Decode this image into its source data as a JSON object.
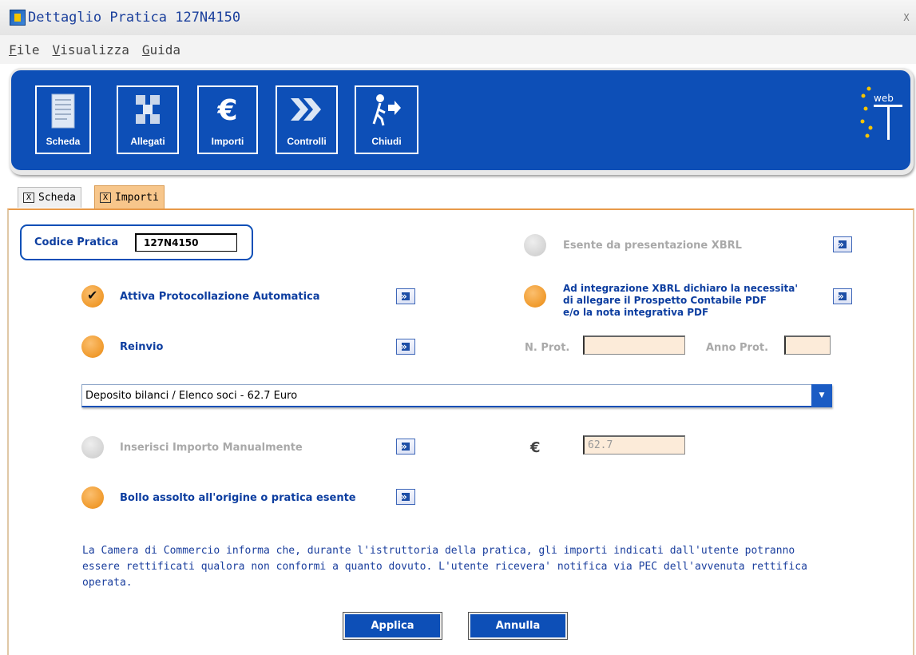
{
  "window": {
    "title": "Dettaglio Pratica 127N4150",
    "close_glyph": "X"
  },
  "menu": [
    {
      "u": "F",
      "rest": "ile"
    },
    {
      "u": "V",
      "rest": "isualizza"
    },
    {
      "u": "G",
      "rest": "uida"
    }
  ],
  "toolbar": {
    "buttons": [
      {
        "label": "Scheda",
        "icon": "document-icon"
      },
      {
        "label": "Allegati",
        "icon": "attachments-icon"
      },
      {
        "label": "Importi",
        "icon": "euro-icon"
      },
      {
        "label": "Controlli",
        "icon": "double-chevron-icon"
      },
      {
        "label": "Chiudi",
        "icon": "exit-walking-icon"
      }
    ],
    "logo_text": "web"
  },
  "tabs": [
    {
      "label": "Scheda",
      "close": "X"
    },
    {
      "label": "Importi",
      "close": "X"
    }
  ],
  "form": {
    "codice_label": "Codice Pratica",
    "codice_value": "127N4150",
    "esente_label": "Esente da presentazione XBRL",
    "attiva_label": "Attiva Protocollazione Automatica",
    "integrazione_lines": [
      "Ad integrazione XBRL dichiaro la necessita'",
      "di allegare il Prospetto Contabile PDF",
      "e/o la nota integrativa PDF"
    ],
    "reinvio_label": "Reinvio",
    "nprot_label": "N. Prot.",
    "nprot_value": "",
    "anno_label": "Anno Prot.",
    "anno_value": "",
    "select_value": "Deposito bilanci / Elenco soci - 62.7 Euro",
    "manuale_label": "Inserisci Importo Manualmente",
    "euro_symbol": "€",
    "importo_value": "62.7",
    "bollo_label": "Bollo assolto all'origine o pratica esente"
  },
  "info_text": "La Camera di Commercio informa che, durante l'istruttoria della pratica, gli importi indicati dall'utente potranno essere rettificati qualora non conformi a quanto dovuto. L'utente ricevera' notifica via PEC dell'avvenuta rettifica operata.",
  "actions": {
    "apply": "Applica",
    "cancel": "Annulla"
  }
}
